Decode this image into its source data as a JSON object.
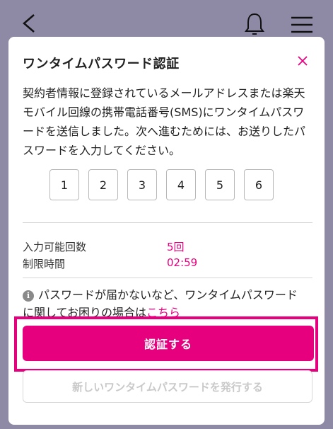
{
  "colors": {
    "accent": "#e6007e",
    "header_bg": "#8e8aa6",
    "text": "#222222",
    "disabled_text": "#c9c9c9"
  },
  "header": {
    "back_icon": "chevron-left-icon",
    "bell_icon": "bell-icon",
    "menu_icon": "hamburger-menu-icon"
  },
  "modal": {
    "title": "ワンタイムパスワード認証",
    "close_icon": "close-icon",
    "description_lines": [
      "契約者情報に登録されているメールアドレスまたは楽天",
      "モバイル回線の携帯電話番号(SMS)にワンタイムパスワ",
      "ードを送信しました。次へ進むためには、お送りしたパ",
      "スワードを入力してください。"
    ],
    "otp_digits": [
      "1",
      "2",
      "3",
      "4",
      "5",
      "6"
    ],
    "attempts_label": "入力可能回数",
    "attempts_value": "5回",
    "time_label": "制限時間",
    "time_value": "02:59",
    "notice_icon": "info-circle-icon",
    "notice_line1": "パスワードが届かないなど、ワンタイムパスワード",
    "notice_line2_prefix": "に関してお困りの場合は",
    "notice_link": "こちら",
    "verify_button": "認証する",
    "resend_button": "新しいワンタイムパスワードを発行する"
  }
}
